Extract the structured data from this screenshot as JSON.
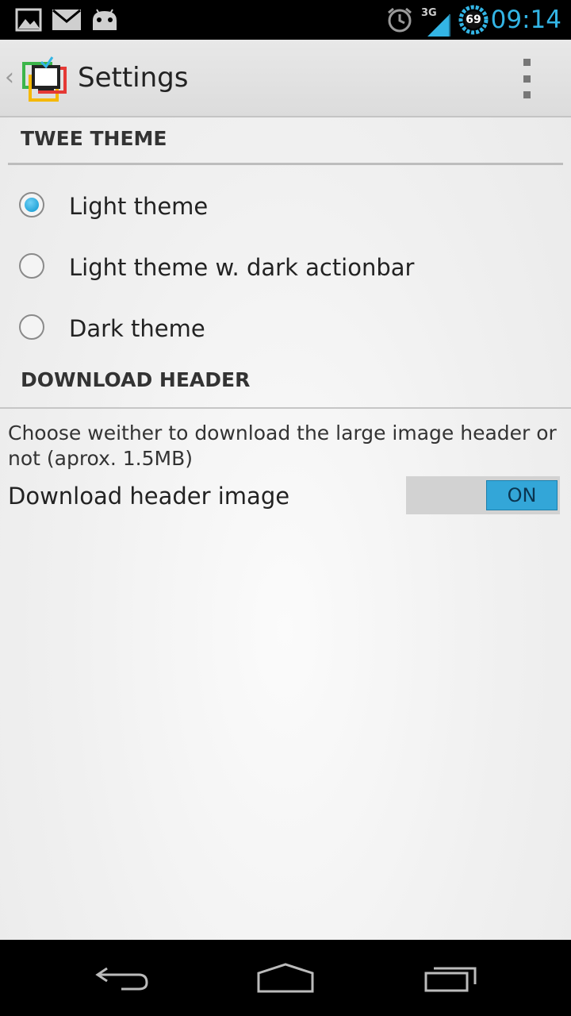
{
  "status_bar": {
    "time": "09:14",
    "network": "3G",
    "battery_level": "69",
    "icons": [
      "gallery-icon",
      "mail-icon",
      "android-icon",
      "alarm-icon",
      "signal-icon",
      "battery-icon"
    ]
  },
  "action_bar": {
    "title": "Settings",
    "app_icon": "tv-logo-icon",
    "overflow_icon": "overflow-menu-icon"
  },
  "theme_section": {
    "header": "TWEE THEME",
    "options": [
      {
        "label": "Light theme",
        "checked": true
      },
      {
        "label": "Light theme w. dark actionbar",
        "checked": false
      },
      {
        "label": "Dark theme",
        "checked": false
      }
    ]
  },
  "download_section": {
    "header": "DOWNLOAD HEADER",
    "description": "Choose weither to download the large image header or not (aprox. 1.5MB)",
    "toggle_label": "Download header image",
    "toggle_state": "ON"
  },
  "nav_bar": {
    "icons": [
      "back-icon",
      "home-icon",
      "recent-apps-icon"
    ]
  },
  "colors": {
    "accent": "#33b5e5",
    "toggle_on": "#33a6d8"
  }
}
